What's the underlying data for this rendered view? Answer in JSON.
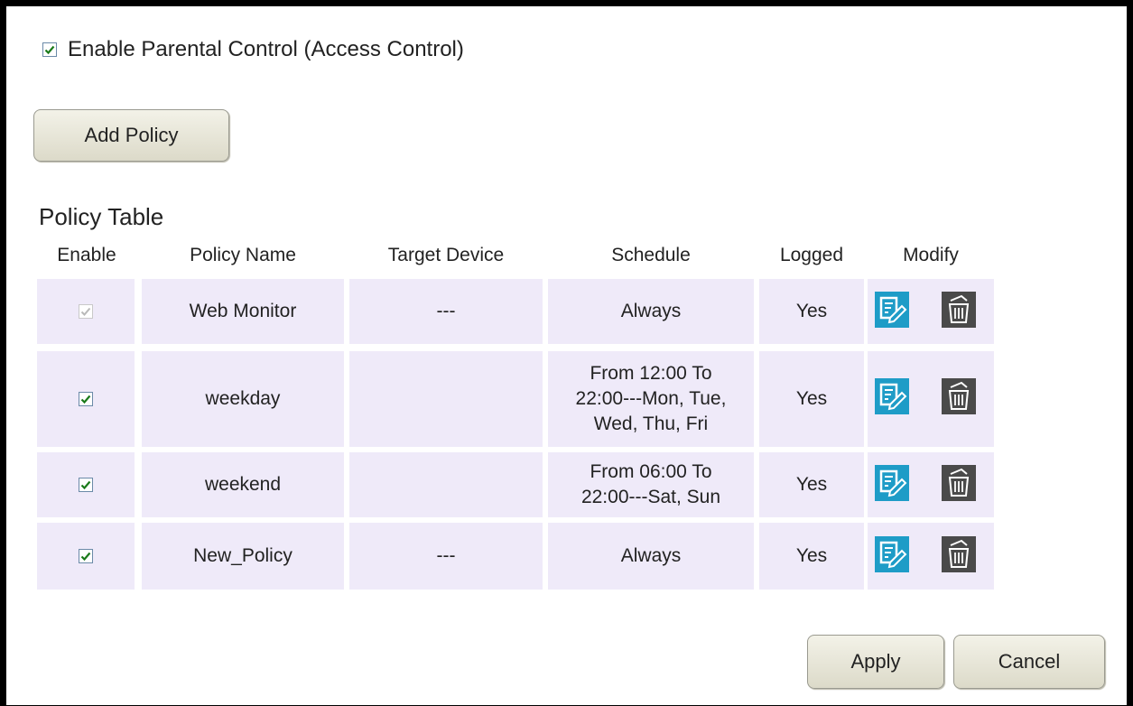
{
  "parental_control": {
    "enable_label": "Enable Parental Control (Access Control)",
    "enabled": true
  },
  "buttons": {
    "add_policy": "Add Policy",
    "apply": "Apply",
    "cancel": "Cancel"
  },
  "policy_table": {
    "title": "Policy Table",
    "headers": {
      "enable": "Enable",
      "policy_name": "Policy Name",
      "target_device": "Target Device",
      "schedule": "Schedule",
      "logged": "Logged",
      "modify": "Modify"
    },
    "rows": [
      {
        "enabled": true,
        "disabled_checkbox": true,
        "name": "Web Monitor",
        "target": "---",
        "schedule": [
          "Always"
        ],
        "logged": "Yes"
      },
      {
        "enabled": true,
        "disabled_checkbox": false,
        "name": "weekday",
        "target": "",
        "schedule": [
          "From 12:00 To",
          "22:00---Mon, Tue,",
          "Wed, Thu, Fri"
        ],
        "logged": "Yes"
      },
      {
        "enabled": true,
        "disabled_checkbox": false,
        "name": "weekend",
        "target": "",
        "schedule": [
          "From 06:00 To",
          "22:00---Sat, Sun"
        ],
        "logged": "Yes"
      },
      {
        "enabled": true,
        "disabled_checkbox": false,
        "name": "New_Policy",
        "target": "---",
        "schedule": [
          "Always"
        ],
        "logged": "Yes"
      }
    ]
  },
  "icons": {
    "edit": "edit-icon",
    "delete": "trash-icon",
    "checkbox": "checkmark-icon"
  },
  "colors": {
    "row_background": "#efeaf9",
    "edit_icon": "#1e9cc7",
    "delete_icon": "#4a4a4a",
    "check": "#1a7a1a"
  }
}
